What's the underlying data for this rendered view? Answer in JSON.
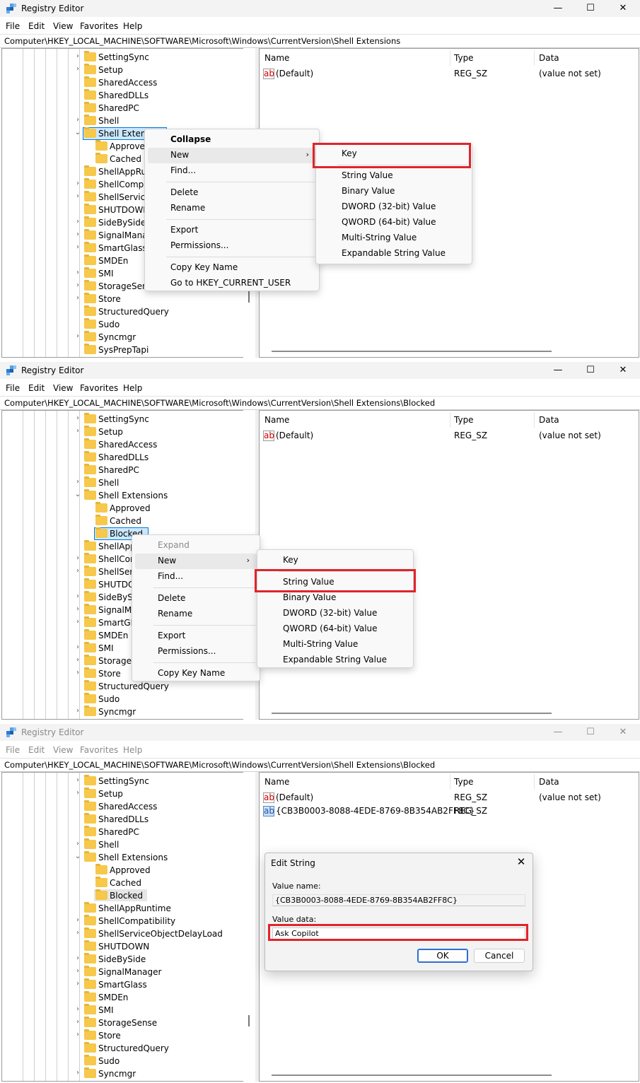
{
  "app_title": "Registry Editor",
  "window_buttons": {
    "minimize": "—",
    "maximize": "☐",
    "close": "✕"
  },
  "menubar": [
    "File",
    "Edit",
    "View",
    "Favorites",
    "Help"
  ],
  "columns": {
    "name": "Name",
    "type": "Type",
    "data": "Data"
  },
  "panels": [
    {
      "address": "Computer\\HKEY_LOCAL_MACHINE\\SOFTWARE\\Microsoft\\Windows\\CurrentVersion\\Shell Extensions",
      "tree": [
        {
          "label": "SettingSync",
          "level": 0,
          "chevron": "right"
        },
        {
          "label": "Setup",
          "level": 0,
          "chevron": "right"
        },
        {
          "label": "SharedAccess",
          "level": 0,
          "chevron": ""
        },
        {
          "label": "SharedDLLs",
          "level": 0,
          "chevron": ""
        },
        {
          "label": "SharedPC",
          "level": 0,
          "chevron": ""
        },
        {
          "label": "Shell",
          "level": 0,
          "chevron": "right"
        },
        {
          "label": "Shell Extensi",
          "level": 0,
          "chevron": "down",
          "selected": true
        },
        {
          "label": "Approvec",
          "level": 1,
          "chevron": ""
        },
        {
          "label": "Cached",
          "level": 1,
          "chevron": ""
        },
        {
          "label": "ShellAppRur",
          "level": 0,
          "chevron": ""
        },
        {
          "label": "ShellCompa",
          "level": 0,
          "chevron": "right"
        },
        {
          "label": "ShellService",
          "level": 0,
          "chevron": "right"
        },
        {
          "label": "SHUTDOWN",
          "level": 0,
          "chevron": ""
        },
        {
          "label": "SideBySide",
          "level": 0,
          "chevron": "right"
        },
        {
          "label": "SignalManag",
          "level": 0,
          "chevron": "right"
        },
        {
          "label": "SmartGlass",
          "level": 0,
          "chevron": "right"
        },
        {
          "label": "SMDEn",
          "level": 0,
          "chevron": ""
        },
        {
          "label": "SMI",
          "level": 0,
          "chevron": "right"
        },
        {
          "label": "StorageSens",
          "level": 0,
          "chevron": "right"
        },
        {
          "label": "Store",
          "level": 0,
          "chevron": "right"
        },
        {
          "label": "StructuredQuery",
          "level": 0,
          "chevron": ""
        },
        {
          "label": "Sudo",
          "level": 0,
          "chevron": ""
        },
        {
          "label": "Syncmgr",
          "level": 0,
          "chevron": "right"
        },
        {
          "label": "SysPrepTapi",
          "level": 0,
          "chevron": ""
        }
      ],
      "values": [
        {
          "name": "(Default)",
          "type": "REG_SZ",
          "data": "(value not set)",
          "icon": "ab"
        }
      ],
      "context_menu": [
        {
          "label": "Collapse",
          "bold": true
        },
        {
          "label": "New",
          "submenu": true,
          "hover": true
        },
        {
          "label": "Find..."
        },
        {
          "sep": true
        },
        {
          "label": "Delete"
        },
        {
          "label": "Rename"
        },
        {
          "sep": true
        },
        {
          "label": "Export"
        },
        {
          "label": "Permissions..."
        },
        {
          "sep": true
        },
        {
          "label": "Copy Key Name"
        },
        {
          "label": "Go to HKEY_CURRENT_USER"
        }
      ],
      "submenu": [
        {
          "label": "Key",
          "highlight": true
        },
        {
          "sep": true
        },
        {
          "label": "String Value"
        },
        {
          "label": "Binary Value"
        },
        {
          "label": "DWORD (32-bit) Value"
        },
        {
          "label": "QWORD (64-bit) Value"
        },
        {
          "label": "Multi-String Value"
        },
        {
          "label": "Expandable String Value"
        }
      ]
    },
    {
      "address": "Computer\\HKEY_LOCAL_MACHINE\\SOFTWARE\\Microsoft\\Windows\\CurrentVersion\\Shell Extensions\\Blocked",
      "tree": [
        {
          "label": "SettingSync",
          "level": 0,
          "chevron": "right"
        },
        {
          "label": "Setup",
          "level": 0,
          "chevron": "right"
        },
        {
          "label": "SharedAccess",
          "level": 0,
          "chevron": ""
        },
        {
          "label": "SharedDLLs",
          "level": 0,
          "chevron": ""
        },
        {
          "label": "SharedPC",
          "level": 0,
          "chevron": ""
        },
        {
          "label": "Shell",
          "level": 0,
          "chevron": "right"
        },
        {
          "label": "Shell Extensions",
          "level": 0,
          "chevron": "down"
        },
        {
          "label": "Approved",
          "level": 1,
          "chevron": ""
        },
        {
          "label": "Cached",
          "level": 1,
          "chevron": ""
        },
        {
          "label": "Blocked",
          "level": 1,
          "chevron": "",
          "selected": true
        },
        {
          "label": "ShellApp",
          "level": 0,
          "chevron": ""
        },
        {
          "label": "ShellCon",
          "level": 0,
          "chevron": "right"
        },
        {
          "label": "ShellServ",
          "level": 0,
          "chevron": "right"
        },
        {
          "label": "SHUTDO",
          "level": 0,
          "chevron": ""
        },
        {
          "label": "SideBySi",
          "level": 0,
          "chevron": "right"
        },
        {
          "label": "SignalMa",
          "level": 0,
          "chevron": "right"
        },
        {
          "label": "SmartGla",
          "level": 0,
          "chevron": "right"
        },
        {
          "label": "SMDEn",
          "level": 0,
          "chevron": ""
        },
        {
          "label": "SMI",
          "level": 0,
          "chevron": "right"
        },
        {
          "label": "StorageS",
          "level": 0,
          "chevron": "right"
        },
        {
          "label": "Store",
          "level": 0,
          "chevron": "right"
        },
        {
          "label": "StructuredQuery",
          "level": 0,
          "chevron": ""
        },
        {
          "label": "Sudo",
          "level": 0,
          "chevron": ""
        },
        {
          "label": "Syncmgr",
          "level": 0,
          "chevron": "right"
        }
      ],
      "values": [
        {
          "name": "(Default)",
          "type": "REG_SZ",
          "data": "(value not set)",
          "icon": "ab"
        }
      ],
      "context_menu": [
        {
          "label": "Expand",
          "disabled": true
        },
        {
          "label": "New",
          "submenu": true,
          "hover": true
        },
        {
          "label": "Find..."
        },
        {
          "sep": true
        },
        {
          "label": "Delete"
        },
        {
          "label": "Rename"
        },
        {
          "sep": true
        },
        {
          "label": "Export"
        },
        {
          "label": "Permissions..."
        },
        {
          "sep": true
        },
        {
          "label": "Copy Key Name"
        }
      ],
      "submenu": [
        {
          "label": "Key"
        },
        {
          "sep": true
        },
        {
          "label": "String Value",
          "highlight": true
        },
        {
          "label": "Binary Value"
        },
        {
          "label": "DWORD (32-bit) Value"
        },
        {
          "label": "QWORD (64-bit) Value"
        },
        {
          "label": "Multi-String Value"
        },
        {
          "label": "Expandable String Value"
        }
      ]
    },
    {
      "address": "Computer\\HKEY_LOCAL_MACHINE\\SOFTWARE\\Microsoft\\Windows\\CurrentVersion\\Shell Extensions\\Blocked",
      "tree": [
        {
          "label": "SettingSync",
          "level": 0,
          "chevron": "right"
        },
        {
          "label": "Setup",
          "level": 0,
          "chevron": "right"
        },
        {
          "label": "SharedAccess",
          "level": 0,
          "chevron": ""
        },
        {
          "label": "SharedDLLs",
          "level": 0,
          "chevron": ""
        },
        {
          "label": "SharedPC",
          "level": 0,
          "chevron": ""
        },
        {
          "label": "Shell",
          "level": 0,
          "chevron": "right"
        },
        {
          "label": "Shell Extensions",
          "level": 0,
          "chevron": "down"
        },
        {
          "label": "Approved",
          "level": 1,
          "chevron": ""
        },
        {
          "label": "Cached",
          "level": 1,
          "chevron": ""
        },
        {
          "label": "Blocked",
          "level": 1,
          "chevron": "",
          "selected_inactive": true
        },
        {
          "label": "ShellAppRuntime",
          "level": 0,
          "chevron": ""
        },
        {
          "label": "ShellCompatibility",
          "level": 0,
          "chevron": "right"
        },
        {
          "label": "ShellServiceObjectDelayLoad",
          "level": 0,
          "chevron": "right"
        },
        {
          "label": "SHUTDOWN",
          "level": 0,
          "chevron": ""
        },
        {
          "label": "SideBySide",
          "level": 0,
          "chevron": "right"
        },
        {
          "label": "SignalManager",
          "level": 0,
          "chevron": "right"
        },
        {
          "label": "SmartGlass",
          "level": 0,
          "chevron": "right"
        },
        {
          "label": "SMDEn",
          "level": 0,
          "chevron": ""
        },
        {
          "label": "SMI",
          "level": 0,
          "chevron": "right"
        },
        {
          "label": "StorageSense",
          "level": 0,
          "chevron": "right"
        },
        {
          "label": "Store",
          "level": 0,
          "chevron": "right"
        },
        {
          "label": "StructuredQuery",
          "level": 0,
          "chevron": ""
        },
        {
          "label": "Sudo",
          "level": 0,
          "chevron": ""
        },
        {
          "label": "Syncmgr",
          "level": 0,
          "chevron": "right"
        }
      ],
      "values": [
        {
          "name": "(Default)",
          "type": "REG_SZ",
          "data": "(value not set)",
          "icon": "ab"
        },
        {
          "name": "{CB3B0003-8088-4EDE-8769-8B354AB2FF8C}",
          "type": "REG_SZ",
          "data": "",
          "icon": "ab-blue"
        }
      ],
      "dialog": {
        "title": "Edit String",
        "value_name_label": "Value name:",
        "value_name": "{CB3B0003-8088-4EDE-8769-8B354AB2FF8C}",
        "value_data_label": "Value data:",
        "value_data": "Ask Copilot",
        "ok": "OK",
        "cancel": "Cancel",
        "close": "✕"
      }
    }
  ],
  "colors": {
    "highlight_box": "#e0242b",
    "selection": "#cce8ff",
    "folder": "#f6c84b"
  }
}
